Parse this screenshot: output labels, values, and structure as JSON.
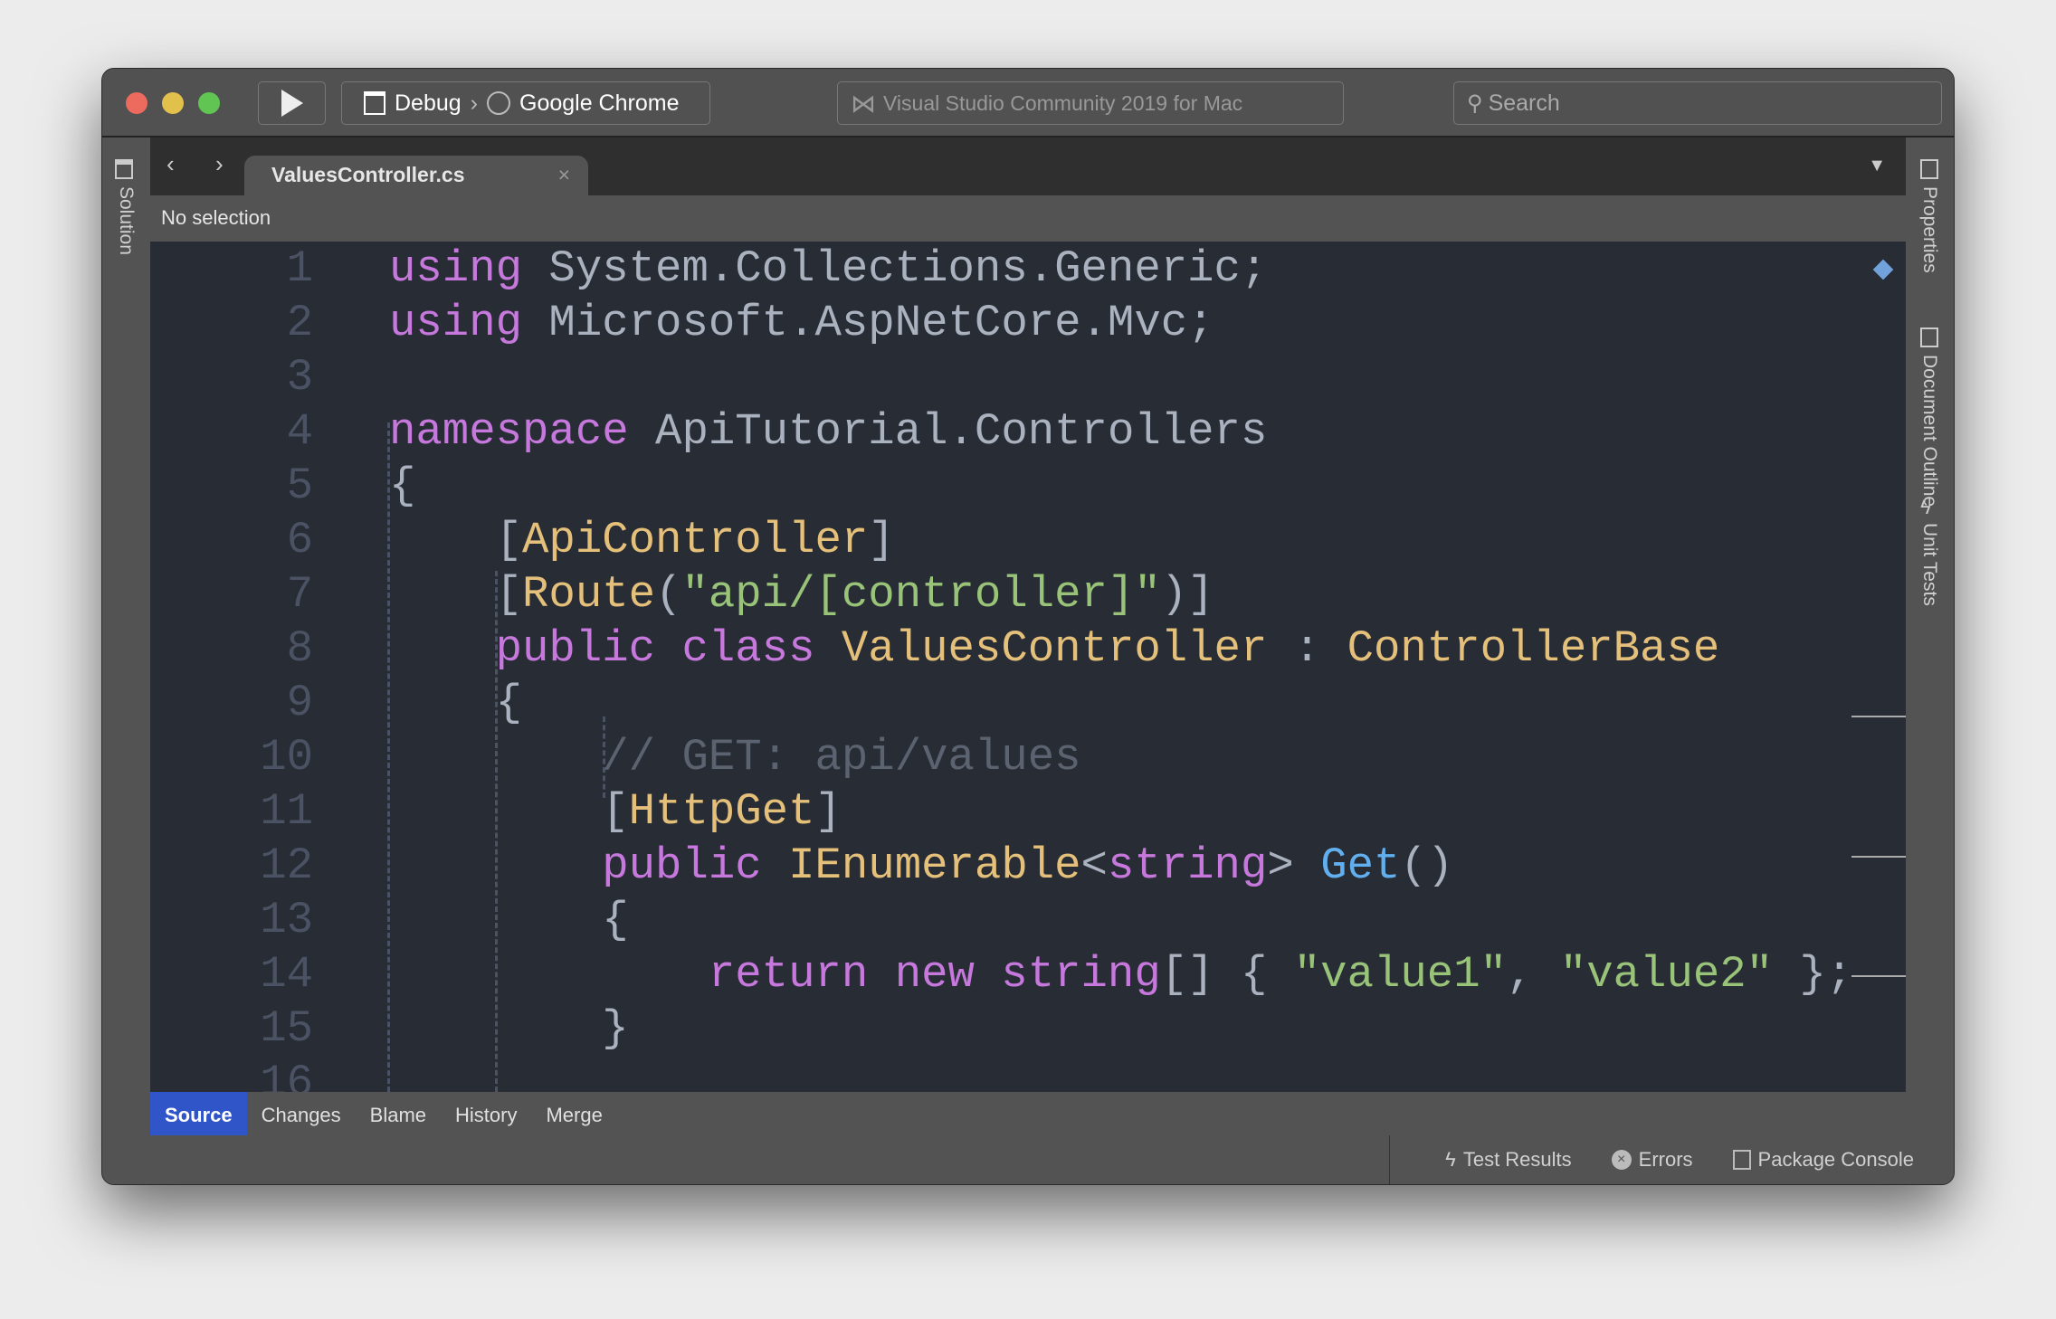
{
  "toolbar": {
    "config": "Debug",
    "target": "Google Chrome",
    "title": "Visual Studio Community 2019 for Mac",
    "search_placeholder": "Search"
  },
  "editor": {
    "tab": "ValuesController.cs",
    "selection": "No selection"
  },
  "sidebar": {
    "left": "Solution",
    "right": [
      "Properties",
      "Document Outline",
      "Unit Tests"
    ]
  },
  "code": {
    "lines": [
      [
        [
          "k",
          "using"
        ],
        [
          "p",
          " System.Collections.Generic;"
        ]
      ],
      [
        [
          "k",
          "using"
        ],
        [
          "p",
          " Microsoft.AspNetCore.Mvc;"
        ]
      ],
      [],
      [
        [
          "k",
          "namespace"
        ],
        [
          "p",
          " ApiTutorial.Controllers"
        ]
      ],
      [
        [
          "p",
          "{"
        ]
      ],
      [
        [
          "p",
          "    ["
        ],
        [
          "t",
          "ApiController"
        ],
        [
          "p",
          "]"
        ]
      ],
      [
        [
          "p",
          "    ["
        ],
        [
          "t",
          "Route"
        ],
        [
          "p",
          "("
        ],
        [
          "s",
          "\"api/[controller]\""
        ],
        [
          "p",
          ")]"
        ]
      ],
      [
        [
          "k",
          "    public class "
        ],
        [
          "t",
          "ValuesController"
        ],
        [
          "p",
          " : "
        ],
        [
          "t",
          "ControllerBase"
        ]
      ],
      [
        [
          "p",
          "    {"
        ]
      ],
      [
        [
          "c",
          "        // GET: api/values"
        ]
      ],
      [
        [
          "p",
          "        ["
        ],
        [
          "t",
          "HttpGet"
        ],
        [
          "p",
          "]"
        ]
      ],
      [
        [
          "k",
          "        public "
        ],
        [
          "t",
          "IEnumerable"
        ],
        [
          "p",
          "<"
        ],
        [
          "k",
          "string"
        ],
        [
          "p",
          "> "
        ],
        [
          "f",
          "Get"
        ],
        [
          "p",
          "()"
        ]
      ],
      [
        [
          "p",
          "        {"
        ]
      ],
      [
        [
          "k",
          "            return new string"
        ],
        [
          "p",
          "[] { "
        ],
        [
          "s",
          "\"value1\""
        ],
        [
          "p",
          ", "
        ],
        [
          "s",
          "\"value2\""
        ],
        [
          "p",
          " };"
        ]
      ],
      [
        [
          "p",
          "        }"
        ]
      ],
      []
    ]
  },
  "bottom_tabs": [
    "Source",
    "Changes",
    "Blame",
    "History",
    "Merge"
  ],
  "status": {
    "test_results": "Test Results",
    "errors": "Errors",
    "package_console": "Package Console"
  },
  "colors": {
    "keyword": "#c678dd",
    "type": "#e5c07b",
    "string": "#98c379",
    "function": "#61afef",
    "comment": "#5c6370",
    "accent": "#2f55c8"
  }
}
